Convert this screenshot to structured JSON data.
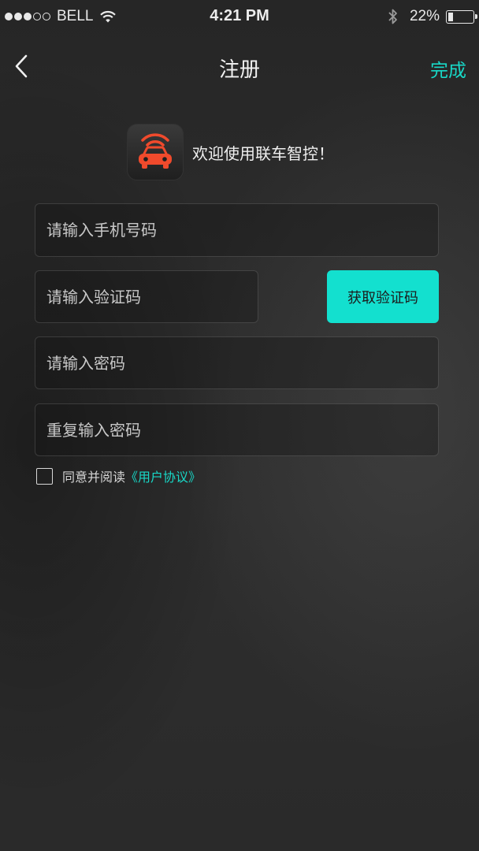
{
  "status_bar": {
    "carrier": "BELL",
    "signal_strength": 3,
    "signal_max": 5,
    "time": "4:21 PM",
    "battery_percent_text": "22%",
    "battery_level": 0.22,
    "icons": [
      "wifi-icon",
      "bluetooth-icon",
      "battery-icon"
    ]
  },
  "nav": {
    "back_icon": "chevron-left-icon",
    "title": "注册",
    "done_label": "完成"
  },
  "welcome": {
    "logo_icon": "car-signal-icon",
    "text": "欢迎使用联车智控！"
  },
  "form": {
    "phone_placeholder": "请输入手机号码",
    "code_placeholder": "请输入验证码",
    "get_code_label": "获取验证码",
    "password_placeholder": "请输入密码",
    "repeat_password_placeholder": "重复输入密码"
  },
  "agreement": {
    "checked": false,
    "text": "同意并阅读",
    "link_text": "《用户协议》"
  },
  "colors": {
    "accent": "#13e0cf",
    "logo_red": "#f04a2c",
    "background": "#2a2a2a"
  }
}
